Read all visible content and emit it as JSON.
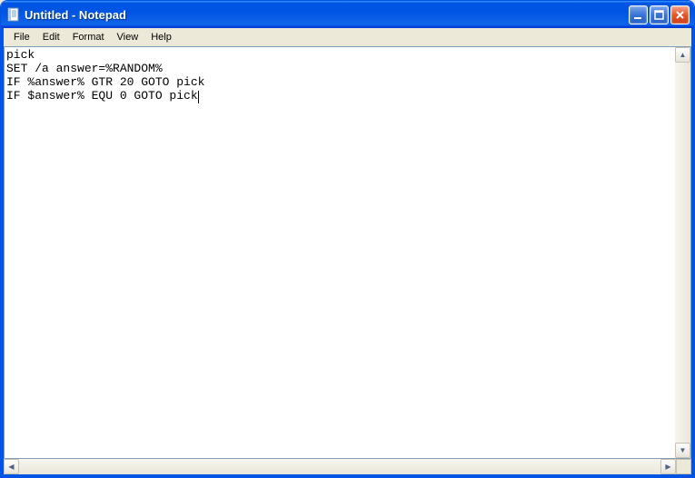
{
  "window": {
    "title": "Untitled - Notepad"
  },
  "menubar": {
    "items": [
      "File",
      "Edit",
      "Format",
      "View",
      "Help"
    ]
  },
  "editor": {
    "content": "pick\nSET /a answer=%RANDOM%\nIF %answer% GTR 20 GOTO pick\nIF $answer% EQU 0 GOTO pick"
  }
}
